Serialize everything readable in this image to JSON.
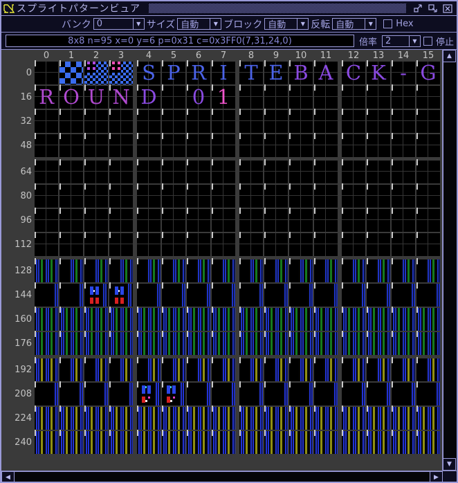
{
  "window": {
    "title": "スプライトパターンビュア"
  },
  "toolbar": {
    "bank_label": "バンク",
    "bank_value": "0",
    "size_label": "サイズ",
    "size_value": "自動",
    "block_label": "ブロック",
    "block_value": "自動",
    "flip_label": "反転",
    "flip_value": "自動",
    "hex_label": "Hex"
  },
  "infobar": {
    "status": "8x8 n=95 x=0 y=6 p=0x31 c=0x3FF0(7,31,24,0)",
    "zoom_label": "倍率",
    "zoom_value": "2",
    "stop_label": "停止"
  },
  "colors": {
    "frame": "#9a9ad8",
    "titlebar_bg": "#0d0d20",
    "accent_text": "#a2a2e2",
    "grid_bg": "#3a3a3a",
    "icon_yellow": "#e8e838",
    "sprite_blue": "#4b63e8",
    "sprite_violet": "#8a4ae0",
    "sprite_purple": "#b04ad0",
    "sprite_pink": "#f055cc",
    "stripe_green": "#157a1e",
    "stripe_blue": "#1f35c8",
    "stripe_olive": "#8f8f12"
  },
  "grid": {
    "col_headers": [
      "0",
      "1",
      "2",
      "3",
      "4",
      "5",
      "6",
      "7",
      "8",
      "9",
      "10",
      "11",
      "12",
      "13",
      "14",
      "15"
    ],
    "rows": [
      {
        "label": "0",
        "cells": [
          "",
          "ck1",
          "ck2",
          "ck3",
          "L:S:c-blue",
          "L:P:c-blue",
          "L:R:c-blue",
          "L:I:c-blue",
          "L:T:c-blue",
          "L:E:c-blue",
          "L:B:c-violet",
          "L:A:c-violet",
          "L:C:c-violet",
          "L:K:c-violet",
          "L:-:c-violet",
          "L:G:c-violet"
        ]
      },
      {
        "label": "16",
        "cells": [
          "L:R:c-purple",
          "L:O:c-purple",
          "L:U:c-purple",
          "L:N:c-purple",
          "L:D:c-violet",
          "",
          "L:0:c-violet",
          "L:1:c-pink",
          "",
          "",
          "",
          "",
          "",
          "",
          "",
          ""
        ]
      },
      {
        "label": "32",
        "cells": [
          "",
          "",
          "",
          "",
          "",
          "",
          "",
          "",
          "",
          "",
          "",
          "",
          "",
          "",
          "",
          ""
        ]
      },
      {
        "label": "48",
        "cells": [
          "",
          "",
          "",
          "",
          "",
          "",
          "",
          "",
          "",
          "",
          "",
          "",
          "",
          "",
          "",
          ""
        ]
      },
      {
        "label": "64",
        "cells": [
          "",
          "",
          "",
          "",
          "",
          "",
          "",
          "",
          "",
          "",
          "",
          "",
          "",
          "",
          "",
          ""
        ]
      },
      {
        "label": "80",
        "cells": [
          "",
          "",
          "",
          "",
          "",
          "",
          "",
          "",
          "",
          "",
          "",
          "",
          "",
          "",
          "",
          ""
        ]
      },
      {
        "label": "96",
        "cells": [
          "",
          "",
          "",
          "",
          "",
          "",
          "",
          "",
          "",
          "",
          "",
          "",
          "",
          "",
          "",
          ""
        ]
      },
      {
        "label": "112",
        "cells": [
          "",
          "",
          "",
          "",
          "",
          "",
          "",
          "",
          "",
          "",
          "",
          "",
          "",
          "",
          "",
          ""
        ]
      },
      {
        "label": "128",
        "cells": [
          "gf",
          "gr",
          "gr",
          "gr",
          "gr",
          "gr",
          "gr",
          "gr",
          "gr",
          "gr",
          "gr",
          "gr",
          "gr",
          "gr",
          "gr",
          "gr"
        ]
      },
      {
        "label": "144",
        "cells": [
          "ge",
          "ge",
          "fr",
          "fr",
          "ge",
          "ge",
          "ge",
          "ge",
          "ge",
          "ge",
          "ge",
          "ge",
          "ge",
          "ge",
          "ge",
          "ge"
        ]
      },
      {
        "label": "160",
        "cells": [
          "gf",
          "gf",
          "gf",
          "gf",
          "gf",
          "gf",
          "gf",
          "gf",
          "gf",
          "gf",
          "gf",
          "gf",
          "gf",
          "gf",
          "gf",
          "gf"
        ]
      },
      {
        "label": "176",
        "cells": [
          "gf",
          "gf",
          "gf",
          "gf",
          "gf",
          "gf",
          "gf",
          "gf",
          "gf",
          "gf",
          "gf",
          "gf",
          "gf",
          "gf",
          "gf",
          "gf"
        ]
      },
      {
        "label": "192",
        "cells": [
          "yf",
          "yr",
          "yr",
          "yr",
          "yr",
          "yr",
          "yr",
          "yr",
          "yr",
          "yr",
          "yr",
          "yr",
          "yr",
          "yr",
          "yr",
          "yr"
        ]
      },
      {
        "label": "208",
        "cells": [
          "ye",
          "ye",
          "ye",
          "ye",
          "fm",
          "fm",
          "ye",
          "ye",
          "ye",
          "ye",
          "ye",
          "ye",
          "ye",
          "ye",
          "ye",
          "ye"
        ]
      },
      {
        "label": "224",
        "cells": [
          "yf",
          "yf",
          "yf",
          "yf",
          "yf",
          "yf",
          "yf",
          "yf",
          "yf",
          "yf",
          "yf",
          "yf",
          "yf",
          "yf",
          "yf",
          "yf"
        ]
      },
      {
        "label": "240",
        "cells": [
          "yf",
          "yf",
          "yf",
          "yf",
          "yf",
          "yf",
          "yf",
          "yf",
          "yf",
          "yf",
          "yf",
          "yf",
          "yf",
          "yf",
          "yf",
          "yf"
        ]
      }
    ]
  }
}
